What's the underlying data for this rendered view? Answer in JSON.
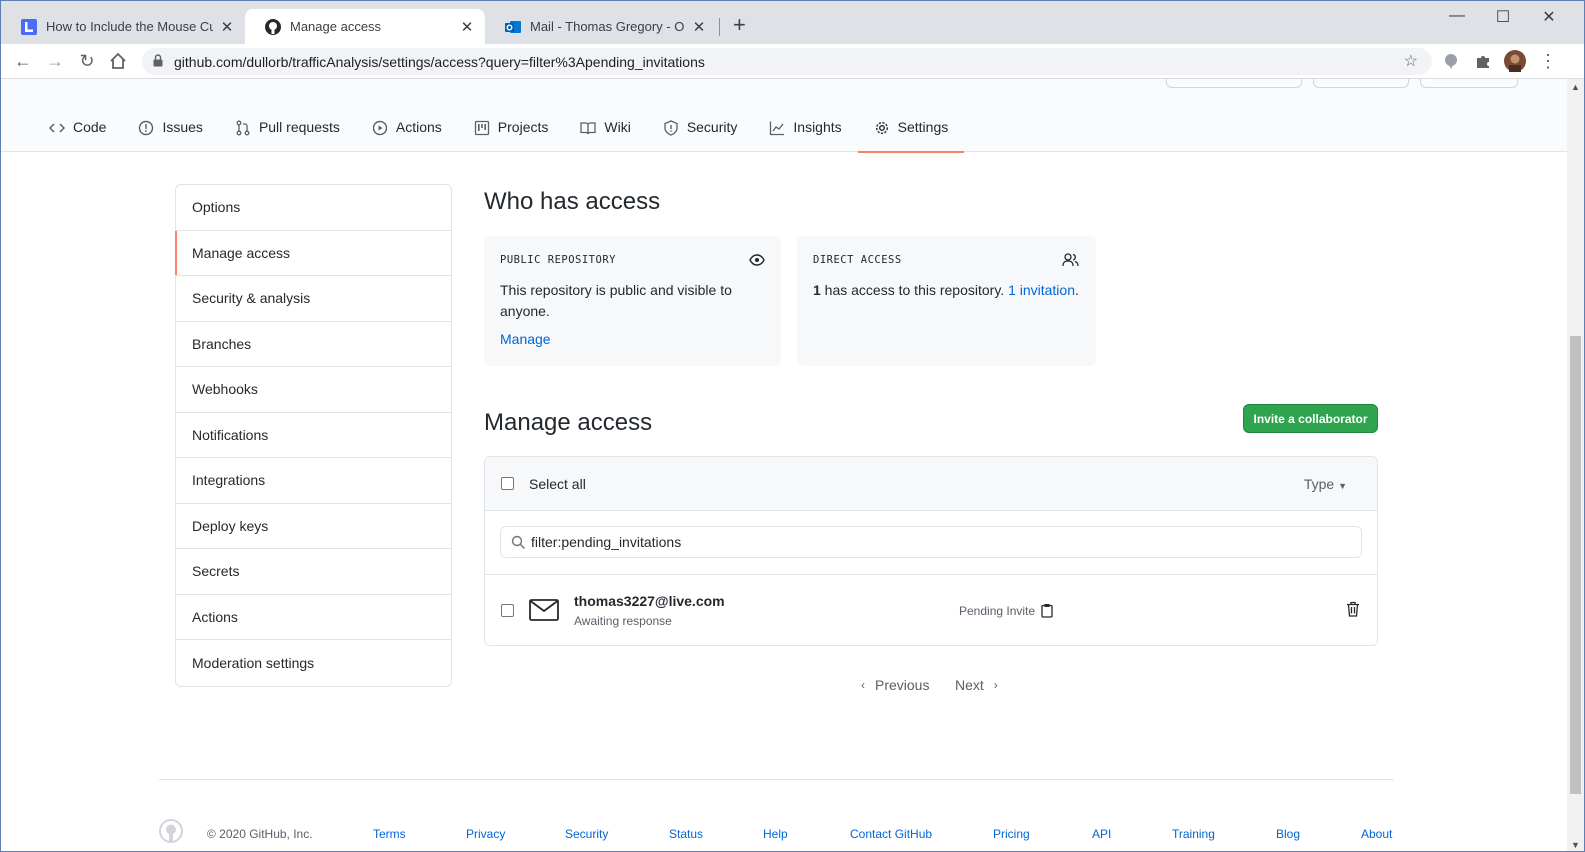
{
  "browser": {
    "tabs": [
      {
        "title": "How to Include the Mouse Cursor",
        "icon": "doc-app-icon"
      },
      {
        "title": "Manage access",
        "icon": "github-icon"
      },
      {
        "title": "Mail - Thomas Gregory - Outlook",
        "icon": "outlook-icon"
      }
    ],
    "url": "github.com/dullorb/trafficAnalysis/settings/access?query=filter%3Apending_invitations"
  },
  "reponav": {
    "items": [
      "Code",
      "Issues",
      "Pull requests",
      "Actions",
      "Projects",
      "Wiki",
      "Security",
      "Insights",
      "Settings"
    ],
    "selected": "Settings"
  },
  "sidebar": {
    "items": [
      "Options",
      "Manage access",
      "Security & analysis",
      "Branches",
      "Webhooks",
      "Notifications",
      "Integrations",
      "Deploy keys",
      "Secrets",
      "Actions",
      "Moderation settings"
    ],
    "selected": "Manage access"
  },
  "who": {
    "title": "Who has access",
    "public": {
      "label": "PUBLIC REPOSITORY",
      "text": "This repository is public and visible to anyone.",
      "link": "Manage"
    },
    "direct": {
      "label": "DIRECT ACCESS",
      "count": "1",
      "text": " has access to this repository. ",
      "link": "1 invitation",
      "suffix": "."
    }
  },
  "manage": {
    "title": "Manage access",
    "invite_button": "Invite a collaborator",
    "select_all": "Select all",
    "type_label": "Type",
    "filter_value": "filter:pending_invitations",
    "rows": [
      {
        "email": "thomas3227@live.com",
        "status": "Awaiting response",
        "badge": "Pending Invite"
      }
    ]
  },
  "pagination": {
    "previous": "Previous",
    "next": "Next"
  },
  "footer": {
    "copyright": "© 2020 GitHub, Inc.",
    "links": [
      "Terms",
      "Privacy",
      "Security",
      "Status",
      "Help",
      "Contact GitHub",
      "Pricing",
      "API",
      "Training",
      "Blog",
      "About"
    ]
  },
  "colors": {
    "accent_underline": "#f9826c",
    "link": "#0366d6",
    "primary_button": "#2ea44f"
  }
}
